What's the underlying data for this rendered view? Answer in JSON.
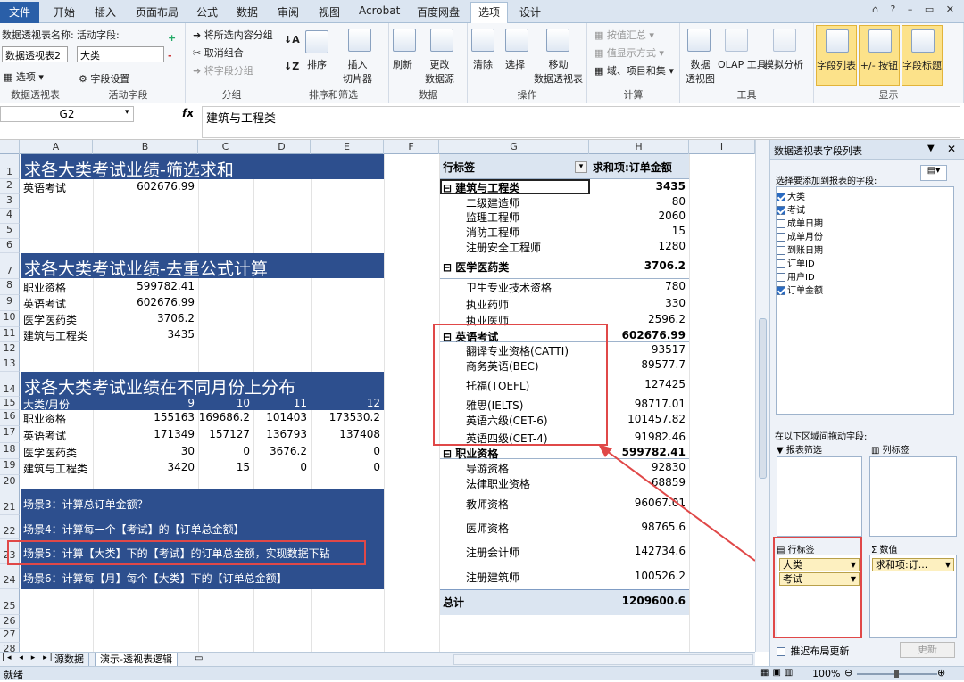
{
  "tabs": {
    "file": "文件",
    "home": "开始",
    "insert": "插入",
    "layout": "页面布局",
    "formulas": "公式",
    "data": "数据",
    "review": "审阅",
    "view": "视图",
    "acrobat": "Acrobat",
    "baidu": "百度网盘",
    "options": "选项",
    "design": "设计"
  },
  "ribbon": {
    "pt_name_label": "数据透视表名称:",
    "pt_name_value": "数据透视表2",
    "options_btn": "选项",
    "group_pt": "数据透视表",
    "active_field_label": "活动字段:",
    "active_field_value": "大类",
    "field_settings": "字段设置",
    "group_active": "活动字段",
    "group_sel": "将所选内容分组",
    "ungroup": "取消组合",
    "group_field": "将字段分组",
    "group_group": "分组",
    "sort": "排序",
    "slicer": "插入\n切片器",
    "group_sort": "排序和筛选",
    "refresh": "刷新",
    "change_source": "更改\n数据源",
    "group_data": "数据",
    "clear": "清除",
    "select": "选择",
    "move": "移动\n数据透视表",
    "group_ops": "操作",
    "summarize": "按值汇总",
    "show_as": "值显示方式",
    "fields_items": "域、项目和集",
    "group_calc": "计算",
    "pivot_chart": "数据\n透视图",
    "olap": "OLAP 工具",
    "whatif": "模拟分析",
    "group_tools": "工具",
    "field_list": "字段列表",
    "plus_minus": "+/- 按钮",
    "field_headers": "字段标题",
    "group_show": "显示"
  },
  "formula_bar": {
    "name_box": "G2",
    "fx": "fx",
    "content": "建筑与工程类"
  },
  "columns": [
    "A",
    "B",
    "C",
    "D",
    "E",
    "F",
    "G",
    "H",
    "I"
  ],
  "rows": [
    "1",
    "2",
    "3",
    "4",
    "5",
    "6",
    "7",
    "8",
    "9",
    "10",
    "11",
    "12",
    "13",
    "14",
    "15",
    "16",
    "17",
    "18",
    "19",
    "20",
    "21",
    "22",
    "23",
    "24",
    "25",
    "26",
    "27",
    "28"
  ],
  "left": {
    "title1": "求各大类考试业绩-筛选求和",
    "r2": {
      "a": "英语考试",
      "b": "602676.99"
    },
    "title2": "求各大类考试业绩-去重公式计算",
    "list2": [
      {
        "a": "职业资格",
        "b": "599782.41"
      },
      {
        "a": "英语考试",
        "b": "602676.99"
      },
      {
        "a": "医学医药类",
        "b": "3706.2"
      },
      {
        "a": "建筑与工程类",
        "b": "3435"
      }
    ],
    "title3": "求各大类考试业绩在不同月份上分布",
    "month_hdr": {
      "a": "大类/月份",
      "b": "9",
      "c": "10",
      "d": "11",
      "e": "12"
    },
    "month_rows": [
      {
        "a": "职业资格",
        "b": "155163",
        "c": "169686.2",
        "d": "101403",
        "e": "173530.2"
      },
      {
        "a": "英语考试",
        "b": "171349",
        "c": "157127",
        "d": "136793",
        "e": "137408"
      },
      {
        "a": "医学医药类",
        "b": "30",
        "c": "0",
        "d": "3676.2",
        "e": "0"
      },
      {
        "a": "建筑与工程类",
        "b": "3420",
        "c": "15",
        "d": "0",
        "e": "0"
      }
    ],
    "scenes": [
      "场景3：计算总订单金额？",
      "场景4：计算每一个【考试】的【订单总金额】",
      "场景5：计算【大类】下的【考试】的订单总金额，实现数据下钻",
      "场景6：计算每【月】每个【大类】下的【订单总金额】"
    ]
  },
  "pivot": {
    "hdr_row": "行标签",
    "hdr_val": "求和项:订单金额",
    "groups": [
      {
        "name": "建筑与工程类",
        "total": "3435",
        "items": [
          {
            "n": "二级建造师",
            "v": "80"
          },
          {
            "n": "监理工程师",
            "v": "2060"
          },
          {
            "n": "消防工程师",
            "v": "15"
          },
          {
            "n": "注册安全工程师",
            "v": "1280"
          }
        ]
      },
      {
        "name": "医学医药类",
        "total": "3706.2",
        "items": [
          {
            "n": "卫生专业技术资格",
            "v": "780"
          },
          {
            "n": "执业药师",
            "v": "330"
          },
          {
            "n": "执业医师",
            "v": "2596.2"
          }
        ]
      },
      {
        "name": "英语考试",
        "total": "602676.99",
        "items": [
          {
            "n": "翻译专业资格(CATTI)",
            "v": "93517"
          },
          {
            "n": "商务英语(BEC)",
            "v": "89577.7"
          },
          {
            "n": "托福(TOEFL)",
            "v": "127425"
          },
          {
            "n": "雅思(IELTS)",
            "v": "98717.01"
          },
          {
            "n": "英语六级(CET-6)",
            "v": "101457.82"
          },
          {
            "n": "英语四级(CET-4)",
            "v": "91982.46"
          }
        ]
      },
      {
        "name": "职业资格",
        "total": "599782.41",
        "items": [
          {
            "n": "导游资格",
            "v": "92830"
          },
          {
            "n": "法律职业资格",
            "v": "68859"
          },
          {
            "n": "教师资格",
            "v": "96067.01"
          },
          {
            "n": "医师资格",
            "v": "98765.6"
          },
          {
            "n": "注册会计师",
            "v": "142734.6"
          },
          {
            "n": "注册建筑师",
            "v": "100526.2"
          }
        ]
      }
    ],
    "grand_label": "总计",
    "grand_value": "1209600.6"
  },
  "pane": {
    "title": "数据透视表字段列表",
    "choose": "选择要添加到报表的字段:",
    "fields": [
      {
        "n": "大类",
        "on": true
      },
      {
        "n": "考试",
        "on": true
      },
      {
        "n": "成单日期",
        "on": false
      },
      {
        "n": "成单月份",
        "on": false
      },
      {
        "n": "到账日期",
        "on": false
      },
      {
        "n": "订单ID",
        "on": false
      },
      {
        "n": "用户ID",
        "on": false
      },
      {
        "n": "订单金额",
        "on": true
      }
    ],
    "drag_hint": "在以下区域间拖动字段:",
    "filter": "报表筛选",
    "col_label": "列标签",
    "row_label": "行标签",
    "values": "数值",
    "row_chips": [
      "大类",
      "考试"
    ],
    "value_chip": "求和项:订...",
    "defer": "推迟布局更新",
    "update": "更新"
  },
  "sheets": [
    "源数据",
    "演示-透视表逻辑"
  ],
  "status": {
    "ready": "就绪",
    "zoom": "100%"
  }
}
